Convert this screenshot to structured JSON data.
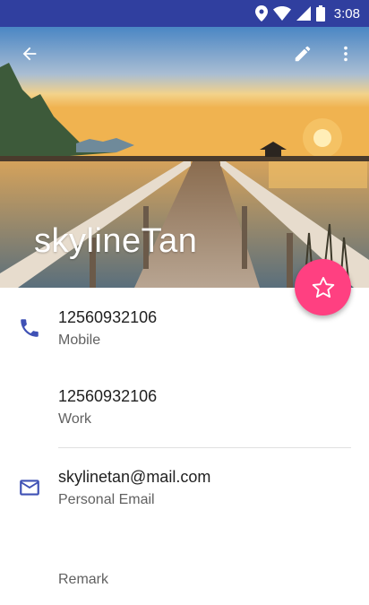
{
  "status_bar": {
    "time": "3:08"
  },
  "header": {
    "contact_name": "skylineTan"
  },
  "colors": {
    "primary_dark": "#303f9f",
    "accent": "#ff4081",
    "icon": "#3f51b5"
  },
  "phones": [
    {
      "number": "12560932106",
      "type": "Mobile"
    },
    {
      "number": "12560932106",
      "type": "Work"
    }
  ],
  "email": {
    "address": "skylinetan@mail.com",
    "type": "Personal Email"
  },
  "remark": {
    "label": "Remark"
  },
  "icons": [
    "back-arrow-icon",
    "edit-pencil-icon",
    "more-vert-icon",
    "star-icon",
    "phone-icon",
    "email-icon",
    "location-icon",
    "wifi-icon",
    "signal-icon",
    "battery-icon"
  ]
}
